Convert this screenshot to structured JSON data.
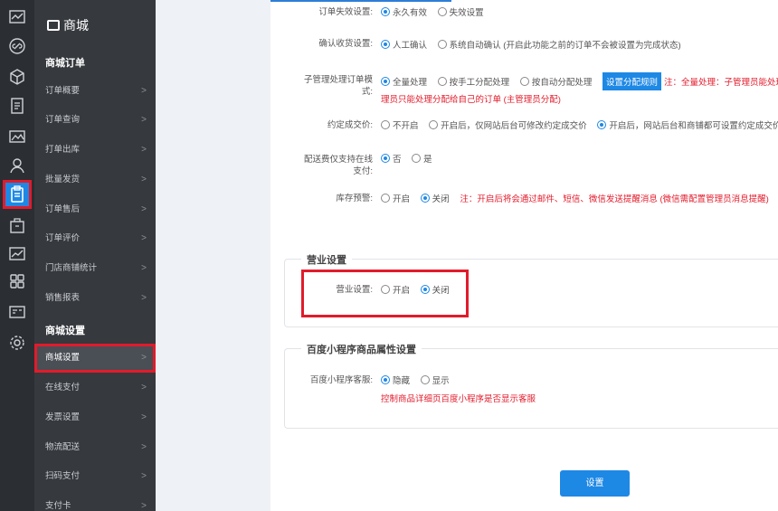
{
  "menu": {
    "brand": "商城",
    "sec_order": "商城订单",
    "sec_settings": "商城设置",
    "items": [
      "订单概要",
      "订单查询",
      "打单出库",
      "批量发货",
      "订单售后",
      "订单评价",
      "门店商铺统计",
      "销售报表",
      "商城设置",
      "在线支付",
      "发票设置",
      "物流配送",
      "扫码支付",
      "支付卡"
    ]
  },
  "form": {
    "expire": {
      "label": "订单失效设置:",
      "opt1": "永久有效",
      "opt2": "失效设置"
    },
    "confirm": {
      "label": "确认收货设置:",
      "opt1": "人工确认",
      "opt2": "系统自动确认 (开启此功能之前的订单不会被设置为完成状态)"
    },
    "sub": {
      "label1": "子管理处理订单模",
      "label2": "式:",
      "opt1": "全量处理",
      "opt2": "按手工分配处理",
      "opt3": "按自动分配处理",
      "btn": "设置分配规则",
      "note": "注：全量处理：子管理员能处理所",
      "note2": "理员只能处理分配给自己的订单 (主管理员分配)"
    },
    "price": {
      "label": "约定成交价:",
      "opt1": "不开启",
      "opt2": "开启后，仅网站后台可修改约定成交价",
      "opt3": "开启后，网站后台和商铺都可设置约定成交价"
    },
    "ship": {
      "label1": "配送费仅支持在线",
      "label2": "支付:",
      "opt1": "否",
      "opt2": "是"
    },
    "stock": {
      "label": "库存预警:",
      "opt1": "开启",
      "opt2": "关闭",
      "note": "注：开启后将会通过邮件、短信、微信发送提醒消息 (微信需配置管理员消息提醒)"
    }
  },
  "business": {
    "legend": "营业设置",
    "label": "营业设置:",
    "opt1": "开启",
    "opt2": "关闭"
  },
  "baidu": {
    "legend": "百度小程序商品属性设置",
    "label": "百度小程序客服:",
    "opt1": "隐藏",
    "opt2": "显示",
    "note": "控制商品详细页百度小程序是否显示客服"
  },
  "save": "设置"
}
